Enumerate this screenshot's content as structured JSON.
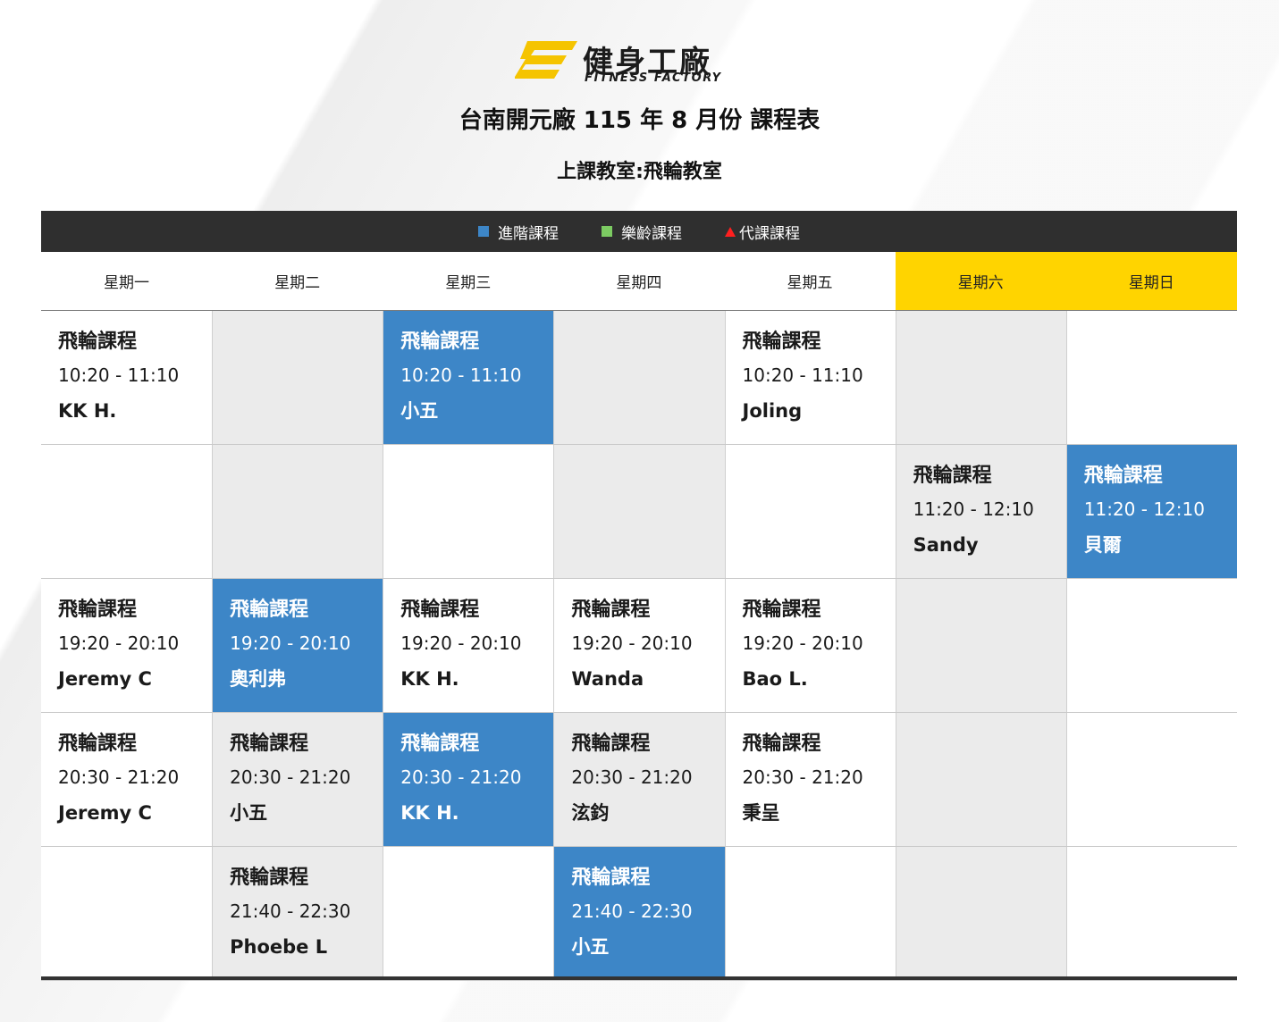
{
  "brand": {
    "name_cn": "健身工廠",
    "name_en": "FITNESS FACTORY",
    "logo_color": "#f5c400"
  },
  "title": "台南開元廠 115 年 8 月份 課程表",
  "subtitle": "上課教室:飛輪教室",
  "legend": [
    {
      "label": "進階課程",
      "color": "#3d86c7",
      "shape": "square"
    },
    {
      "label": "樂齡課程",
      "color": "#7ccb62",
      "shape": "square"
    },
    {
      "label": "代課課程",
      "color": "#ff1f1f",
      "shape": "triangle"
    }
  ],
  "days": [
    "星期一",
    "星期二",
    "星期三",
    "星期四",
    "星期五",
    "星期六",
    "星期日"
  ],
  "weekend_color": "#ffd400",
  "rows": [
    [
      {
        "bg": "white",
        "name": "飛輪課程",
        "time": "10:20 - 11:10",
        "instructor": "KK H."
      },
      {
        "bg": "gray"
      },
      {
        "bg": "blue",
        "name": "飛輪課程",
        "time": "10:20 - 11:10",
        "instructor": "小五"
      },
      {
        "bg": "gray"
      },
      {
        "bg": "white",
        "name": "飛輪課程",
        "time": "10:20 - 11:10",
        "instructor": "Joling"
      },
      {
        "bg": "gray"
      },
      {
        "bg": "white"
      }
    ],
    [
      {
        "bg": "white"
      },
      {
        "bg": "gray"
      },
      {
        "bg": "white"
      },
      {
        "bg": "gray"
      },
      {
        "bg": "white"
      },
      {
        "bg": "gray",
        "name": "飛輪課程",
        "time": "11:20 - 12:10",
        "instructor": "Sandy"
      },
      {
        "bg": "blue",
        "name": "飛輪課程",
        "time": "11:20 - 12:10",
        "instructor": "貝爾"
      }
    ],
    [
      {
        "bg": "white",
        "name": "飛輪課程",
        "time": "19:20 - 20:10",
        "instructor": "Jeremy C"
      },
      {
        "bg": "blue",
        "name": "飛輪課程",
        "time": "19:20 - 20:10",
        "instructor": "奧利弗"
      },
      {
        "bg": "white",
        "name": "飛輪課程",
        "time": "19:20 - 20:10",
        "instructor": "KK H."
      },
      {
        "bg": "white",
        "name": "飛輪課程",
        "time": "19:20 - 20:10",
        "instructor": "Wanda"
      },
      {
        "bg": "white",
        "name": "飛輪課程",
        "time": "19:20 - 20:10",
        "instructor": "Bao L."
      },
      {
        "bg": "gray"
      },
      {
        "bg": "white"
      }
    ],
    [
      {
        "bg": "white",
        "name": "飛輪課程",
        "time": "20:30 - 21:20",
        "instructor": "Jeremy C"
      },
      {
        "bg": "gray",
        "name": "飛輪課程",
        "time": "20:30 - 21:20",
        "instructor": "小五"
      },
      {
        "bg": "blue",
        "name": "飛輪課程",
        "time": "20:30 - 21:20",
        "instructor": "KK H."
      },
      {
        "bg": "gray",
        "name": "飛輪課程",
        "time": "20:30 - 21:20",
        "instructor": "泫鈞"
      },
      {
        "bg": "white",
        "name": "飛輪課程",
        "time": "20:30 - 21:20",
        "instructor": "秉呈"
      },
      {
        "bg": "gray"
      },
      {
        "bg": "white"
      }
    ],
    [
      {
        "bg": "white"
      },
      {
        "bg": "gray",
        "name": "飛輪課程",
        "time": "21:40 - 22:30",
        "instructor": "Phoebe L"
      },
      {
        "bg": "white"
      },
      {
        "bg": "blue",
        "name": "飛輪課程",
        "time": "21:40 - 22:30",
        "instructor": "小五"
      },
      {
        "bg": "white"
      },
      {
        "bg": "gray"
      },
      {
        "bg": "white"
      }
    ]
  ]
}
